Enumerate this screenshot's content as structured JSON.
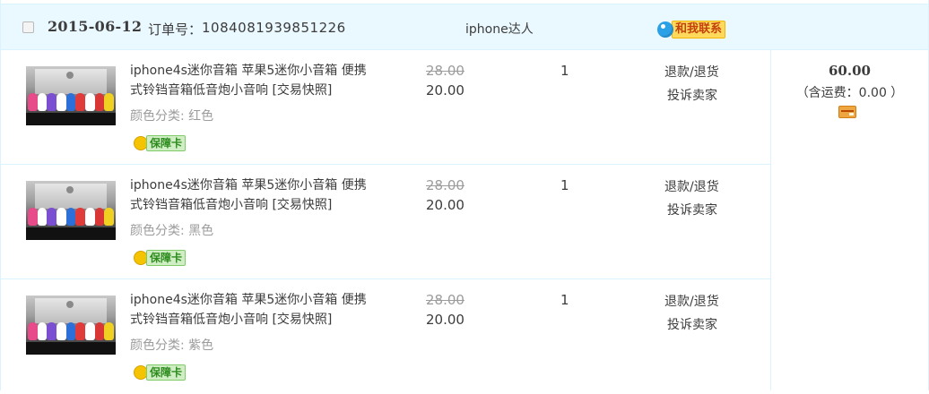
{
  "order": {
    "date": "2015-06-12",
    "order_no_label": "订单号：",
    "order_no": "1084081939851226",
    "shop_name": "iphone达人",
    "contact_label": "和我联系",
    "total": "60.00",
    "shipping": "（含运费：0.00 ）"
  },
  "items": [
    {
      "title": "iphone4s迷你音箱 苹果5迷你小音箱 便携式铃铛音箱低音炮小音响 [交易快照]",
      "sku": "颜色分类: 红色",
      "warranty": "保障卡",
      "original_price": "28.00",
      "price": "20.00",
      "quantity": "1",
      "refund": "退款/退货",
      "complain": "投诉卖家"
    },
    {
      "title": "iphone4s迷你音箱 苹果5迷你小音箱 便携式铃铛音箱低音炮小音响 [交易快照]",
      "sku": "颜色分类: 黑色",
      "warranty": "保障卡",
      "original_price": "28.00",
      "price": "20.00",
      "quantity": "1",
      "refund": "退款/退货",
      "complain": "投诉卖家"
    },
    {
      "title": "iphone4s迷你音箱 苹果5迷你小音箱 便携式铃铛音箱低音炮小音响 [交易快照]",
      "sku": "颜色分类: 紫色",
      "warranty": "保障卡",
      "original_price": "28.00",
      "price": "20.00",
      "quantity": "1",
      "refund": "退款/退货",
      "complain": "投诉卖家"
    }
  ],
  "icons": {
    "contact": "chat-bubble-icon",
    "warranty": "coin-icon",
    "payment": "card-icon"
  },
  "colors": {
    "header_bg": "#eaf8ff",
    "border": "#daf3ff",
    "text": "#3c3c3c",
    "muted": "#9c9c9c"
  }
}
